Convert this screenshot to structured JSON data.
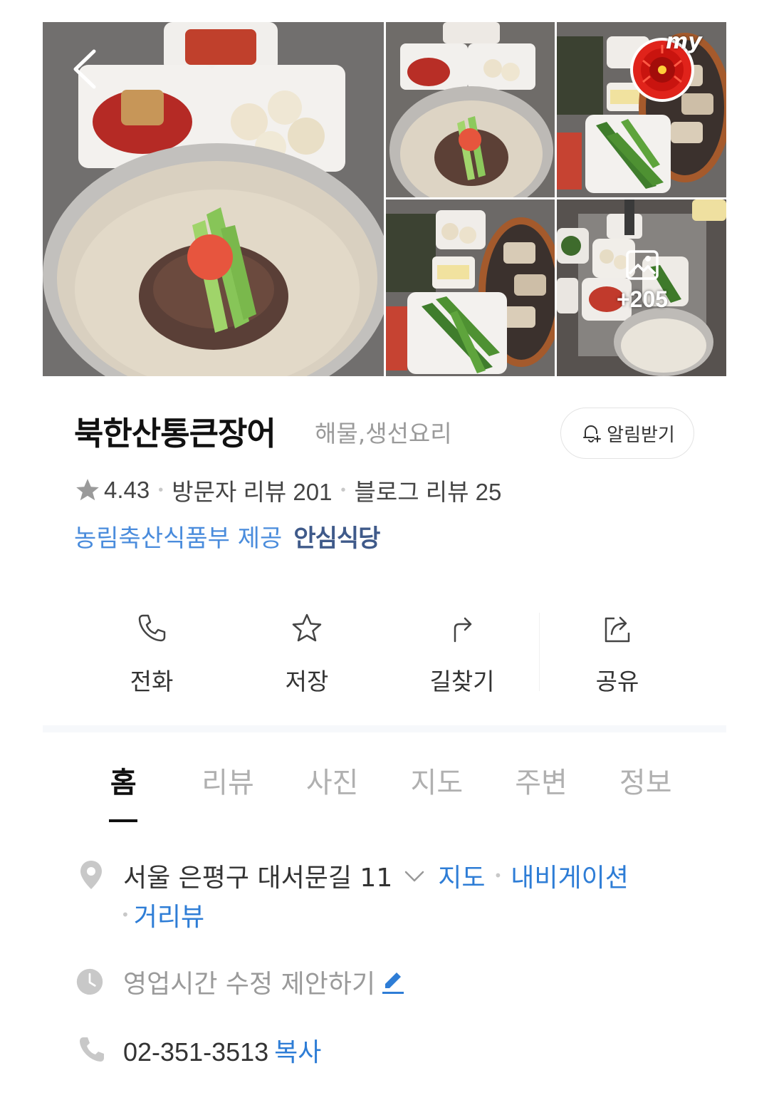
{
  "place": {
    "name": "북한산통큰장어",
    "category": "해물,생선요리",
    "notify_label": "알림받기",
    "rating": "4.43",
    "visitor_reviews": "방문자 리뷰 201",
    "blog_reviews": "블로그 리뷰 25",
    "cert_provider": "농림축산식품부 제공",
    "cert_name": "안심식당"
  },
  "gallery": {
    "more_count": "+205",
    "badge_text": "my"
  },
  "actions": [
    {
      "label": "전화",
      "icon": "phone-icon"
    },
    {
      "label": "저장",
      "icon": "star-icon"
    },
    {
      "label": "길찾기",
      "icon": "directions-icon"
    },
    {
      "label": "공유",
      "icon": "share-icon"
    }
  ],
  "tabs": [
    "홈",
    "리뷰",
    "사진",
    "지도",
    "주변",
    "정보"
  ],
  "active_tab": "홈",
  "info": {
    "address": "서울 은평구 대서문길 11",
    "map_link": "지도",
    "navigation_link": "내비게이션",
    "streetview_link": "거리뷰",
    "hours_suggest": "영업시간 수정 제안하기",
    "phone": "02-351-3513",
    "copy_label": "복사"
  },
  "colors": {
    "link_blue": "#2e7dd6",
    "cert_blue": "#4a8cdc",
    "cert_badge": "#3f5a8a",
    "muted_gray": "#9a9a9a"
  }
}
